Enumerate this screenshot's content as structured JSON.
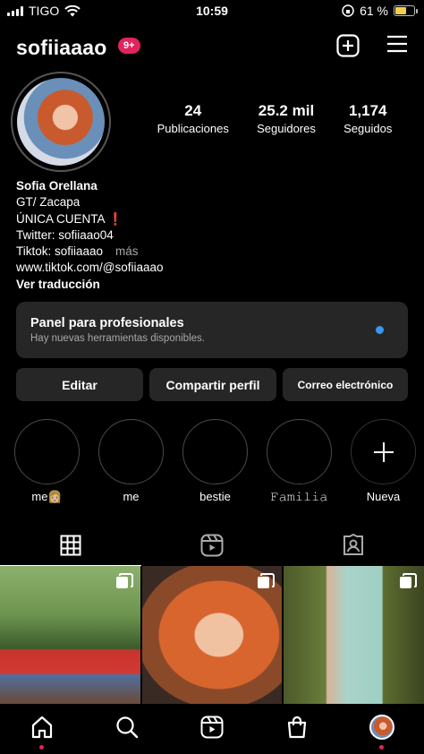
{
  "status_bar": {
    "carrier": "TIGO",
    "time": "10:59",
    "battery_percent": "61 %",
    "battery_level": 0.61
  },
  "header": {
    "username": "sofiiaaao",
    "notifications_badge": "9+"
  },
  "stats": [
    {
      "value": "24",
      "label": "Publicaciones"
    },
    {
      "value": "25.2 mil",
      "label": "Seguidores"
    },
    {
      "value": "1,174",
      "label": "Seguidos"
    }
  ],
  "bio": {
    "name": "Sofia Orellana",
    "lines": [
      "GT/ Zacapa",
      "ÚNICA CUENTA ❗",
      "Twitter: sofiiaao04",
      "Tiktok: sofiiaaao"
    ],
    "more": "más",
    "link": "www.tiktok.com/@sofiiaaao",
    "translate": "Ver traducción"
  },
  "pro_panel": {
    "title": "Panel para profesionales",
    "subtitle": "Hay nuevas herramientas disponibles."
  },
  "buttons": {
    "edit": "Editar",
    "share": "Compartir perfil",
    "email": "Correo electrónico"
  },
  "highlights": [
    {
      "label": "me👩🏼"
    },
    {
      "label": "me"
    },
    {
      "label": "bestie"
    },
    {
      "label": "𝙵𝚊𝚖𝚒𝚕𝚒𝚊"
    },
    {
      "label": "Nueva"
    }
  ],
  "tabs": [
    "grid-icon",
    "reels-icon",
    "tagged-icon"
  ],
  "colors": {
    "accent_blue": "#3897f0",
    "badge_red": "#e0245e",
    "panel_bg": "#262626"
  }
}
